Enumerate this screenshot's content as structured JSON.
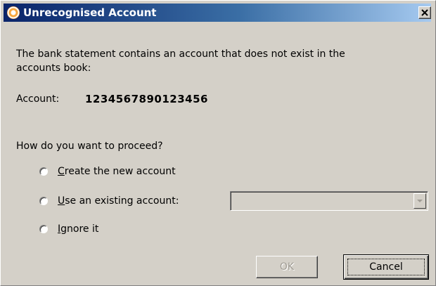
{
  "dialog": {
    "title": "Unrecognised Account",
    "close_label": "×",
    "message_line1": "The bank statement contains an account that does not exist in the",
    "message_line2": "accounts book:",
    "account_label": "Account:",
    "account_number": "1234567890123456",
    "question": "How do you want to proceed?",
    "options": [
      {
        "mnemonic": "C",
        "rest": "reate the new account",
        "selected": false
      },
      {
        "mnemonic": "U",
        "rest": "se an existing account:",
        "selected": false
      },
      {
        "mnemonic": "I",
        "rest": "gnore it",
        "selected": false
      }
    ],
    "existing_account_select": {
      "value": "",
      "enabled": false
    },
    "ok_label": "OK",
    "ok_enabled": false,
    "cancel_label": "Cancel"
  },
  "colors": {
    "titlebar_start": "#0a246a",
    "titlebar_end": "#a6caf0",
    "face": "#d4d0c8",
    "disabled_text": "#a09c94"
  }
}
